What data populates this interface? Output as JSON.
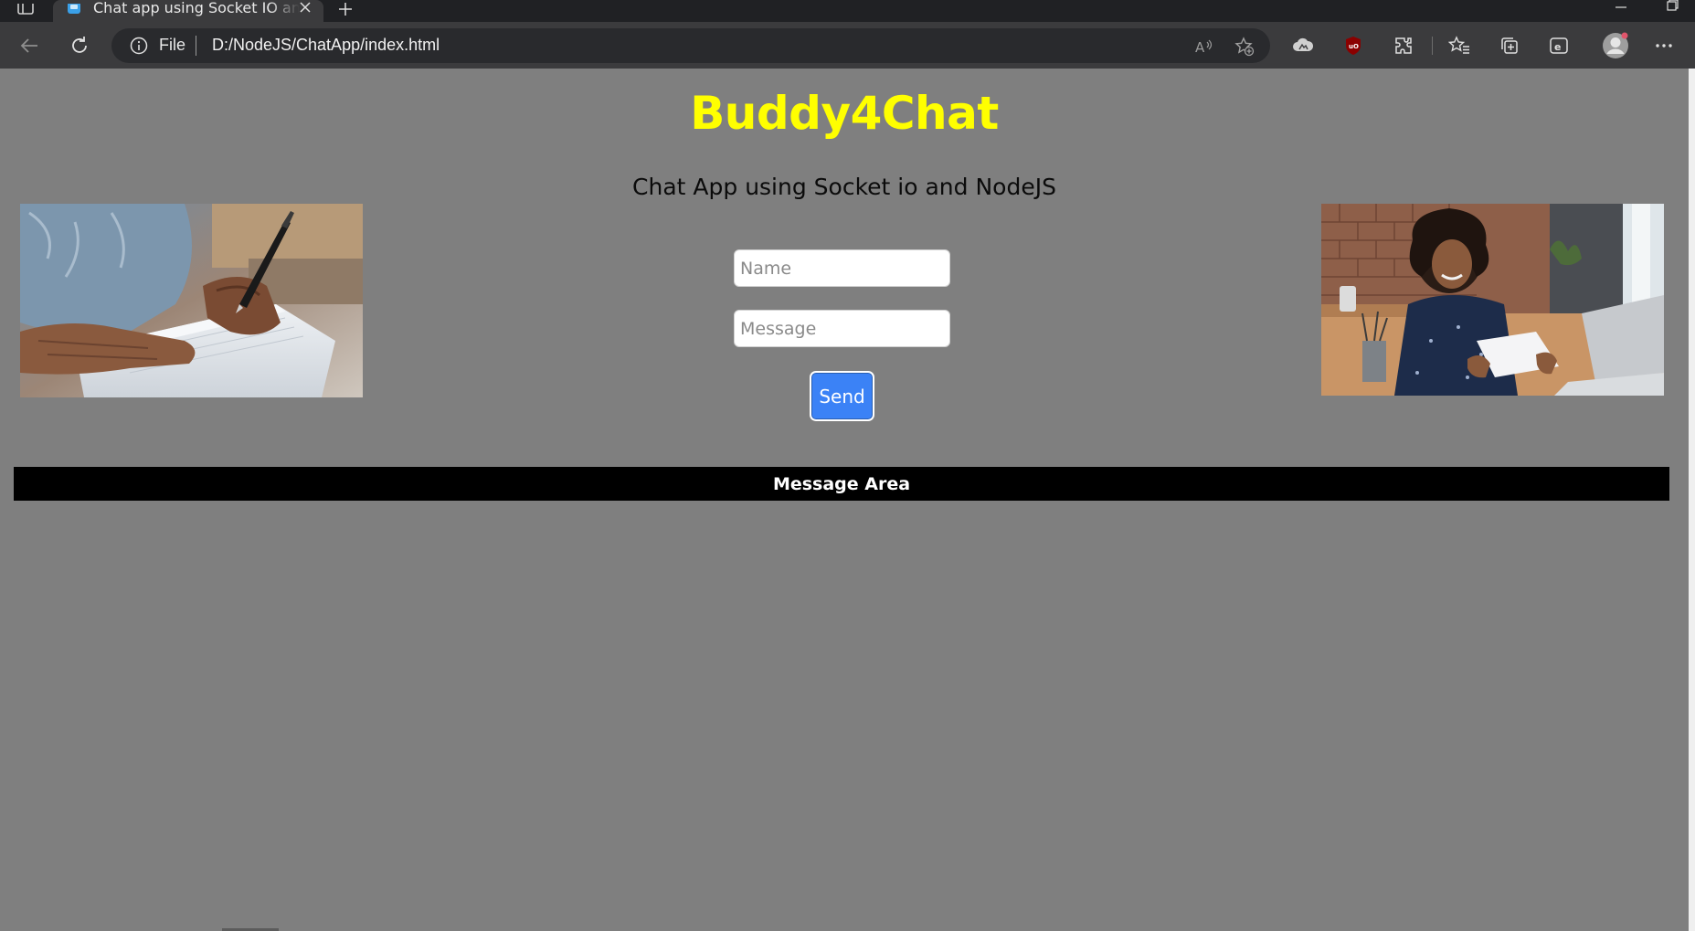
{
  "browser": {
    "tab": {
      "title": "Chat app using Socket IO and NodeJS",
      "favicon": "browser-page-icon"
    },
    "address_bar": {
      "scheme_label": "File",
      "url": "D:/NodeJS/ChatApp/index.html"
    },
    "toolbar_icons": [
      "back-icon",
      "refresh-icon",
      "read-aloud-icon",
      "add-favorite-icon",
      "cloud-extension-icon",
      "ublock-icon",
      "extensions-icon",
      "favorites-icon",
      "collections-icon",
      "ie-mode-icon",
      "profile-icon",
      "more-icon"
    ]
  },
  "page": {
    "title": "Buddy4Chat",
    "subtitle": "Chat App using Socket io and NodeJS",
    "form": {
      "name_placeholder": "Name",
      "message_placeholder": "Message",
      "send_label": "Send"
    },
    "message_area_label": "Message Area",
    "messages": []
  },
  "colors": {
    "page_background": "#7f7f7f",
    "title": "#ffff00",
    "send_button": "#3b82f6",
    "message_area_bar": "#000000"
  }
}
